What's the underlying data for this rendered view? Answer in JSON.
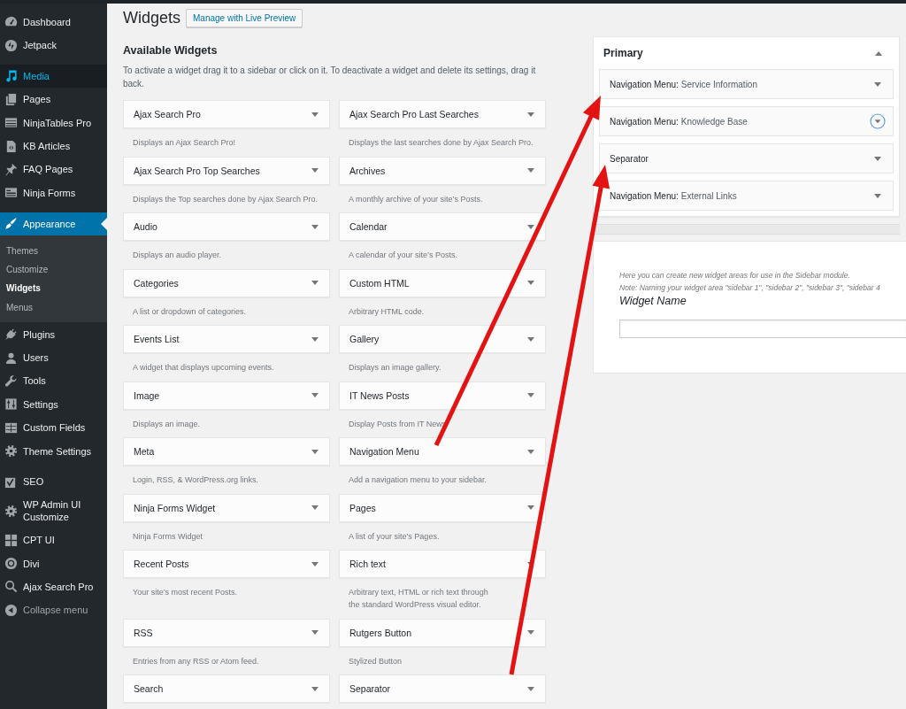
{
  "admin_menu": {
    "groups": [
      {
        "items": [
          {
            "label": "Dashboard",
            "hovered": false,
            "selected": false
          },
          {
            "label": "Jetpack",
            "hovered": false,
            "selected": false
          }
        ]
      },
      {
        "items": [
          {
            "label": "Media",
            "hovered": true,
            "selected": false
          },
          {
            "label": "Pages",
            "hovered": false,
            "selected": false
          },
          {
            "label": "NinjaTables Pro",
            "hovered": false,
            "selected": false
          },
          {
            "label": "KB Articles",
            "hovered": false,
            "selected": false
          },
          {
            "label": "FAQ Pages",
            "hovered": false,
            "selected": false
          },
          {
            "label": "Ninja Forms",
            "hovered": false,
            "selected": false
          }
        ]
      },
      {
        "items": [
          {
            "label": "Appearance",
            "hovered": false,
            "selected": true,
            "children": [
              {
                "label": "Themes",
                "selected": false
              },
              {
                "label": "Customize",
                "selected": false
              },
              {
                "label": "Widgets",
                "selected": true
              },
              {
                "label": "Menus",
                "selected": false
              }
            ]
          },
          {
            "label": "Plugins",
            "hovered": false,
            "selected": false
          },
          {
            "label": "Users",
            "hovered": false,
            "selected": false
          },
          {
            "label": "Tools",
            "hovered": false,
            "selected": false
          },
          {
            "label": "Settings",
            "hovered": false,
            "selected": false
          },
          {
            "label": "Custom Fields",
            "hovered": false,
            "selected": false
          },
          {
            "label": "Theme Settings",
            "hovered": false,
            "selected": false
          }
        ]
      },
      {
        "items": [
          {
            "label": "SEO",
            "hovered": false,
            "selected": false
          },
          {
            "label": "WP Admin UI Customize",
            "hovered": false,
            "selected": false
          },
          {
            "label": "CPT UI",
            "hovered": false,
            "selected": false
          },
          {
            "label": "Divi",
            "hovered": false,
            "selected": false
          },
          {
            "label": "Ajax Search Pro",
            "hovered": false,
            "selected": false
          }
        ]
      }
    ],
    "collapse_menu": {
      "label": "Collapse menu"
    }
  },
  "page_header": {
    "title": "Widgets",
    "button": "Manage with Live Preview"
  },
  "available_widgets": {
    "title": "Available Widgets",
    "description": "To activate a widget drag it to a sidebar or click on it. To deactivate a widget and delete its settings, drag it back.",
    "widgets": [
      {
        "title": "Ajax Search Pro",
        "description": "Displays an Ajax Search Pro!"
      },
      {
        "title": "Ajax Search Pro Last Searches",
        "description": "Displays the last searches done by Ajax Search Pro."
      },
      {
        "title": "Ajax Search Pro Top Searches",
        "description": "Displays the Top searches done by Ajax Search Pro."
      },
      {
        "title": "Archives",
        "description": "A monthly archive of your site’s Posts."
      },
      {
        "title": "Audio",
        "description": "Displays an audio player."
      },
      {
        "title": "Calendar",
        "description": "A calendar of your site’s Posts."
      },
      {
        "title": "Categories",
        "description": "A list or dropdown of categories."
      },
      {
        "title": "Custom HTML",
        "description": "Arbitrary HTML code."
      },
      {
        "title": "Events List",
        "description": "A widget that displays upcoming events."
      },
      {
        "title": "Gallery",
        "description": "Displays an image gallery."
      },
      {
        "title": "Image",
        "description": "Displays an image."
      },
      {
        "title": "IT News Posts",
        "description": "Display Posts from IT News"
      },
      {
        "title": "Meta",
        "description": "Login, RSS, & WordPress.org links."
      },
      {
        "title": "Navigation Menu",
        "description": "Add a navigation menu to your sidebar."
      },
      {
        "title": "Ninja Forms Widget",
        "description": "Ninja Forms Widget"
      },
      {
        "title": "Pages",
        "description": "A list of your site’s Pages."
      },
      {
        "title": "Recent Posts",
        "description": "Your site’s most recent Posts."
      },
      {
        "title": "Rich text",
        "description": "Arbitrary text, HTML or rich text through the standard WordPress visual editor."
      },
      {
        "title": "RSS",
        "description": "Entries from any RSS or Atom feed."
      },
      {
        "title": "Rutgers Button",
        "description": "Stylized Button"
      },
      {
        "title": "Search"
      },
      {
        "title": "Separator"
      }
    ]
  },
  "primary_sidebar": {
    "title": "Primary",
    "expanded": true,
    "widgets": [
      {
        "title": "Navigation Menu:",
        "subtitle": "Service Information",
        "focused": false
      },
      {
        "title": "Navigation Menu:",
        "subtitle": "Knowledge Base",
        "focused": true
      },
      {
        "title": "Separator",
        "focused": false
      },
      {
        "title": "Navigation Menu:",
        "subtitle": "External Links",
        "focused": false
      }
    ]
  },
  "widget_area_creator": {
    "help": "Here you can create new widget areas for use in the Sidebar module.",
    "note": "Note: Naming your widget area \"sidebar 1\", \"sidebar 2\", \"sidebar 3\", \"sidebar 4",
    "label": "Widget Name"
  }
}
